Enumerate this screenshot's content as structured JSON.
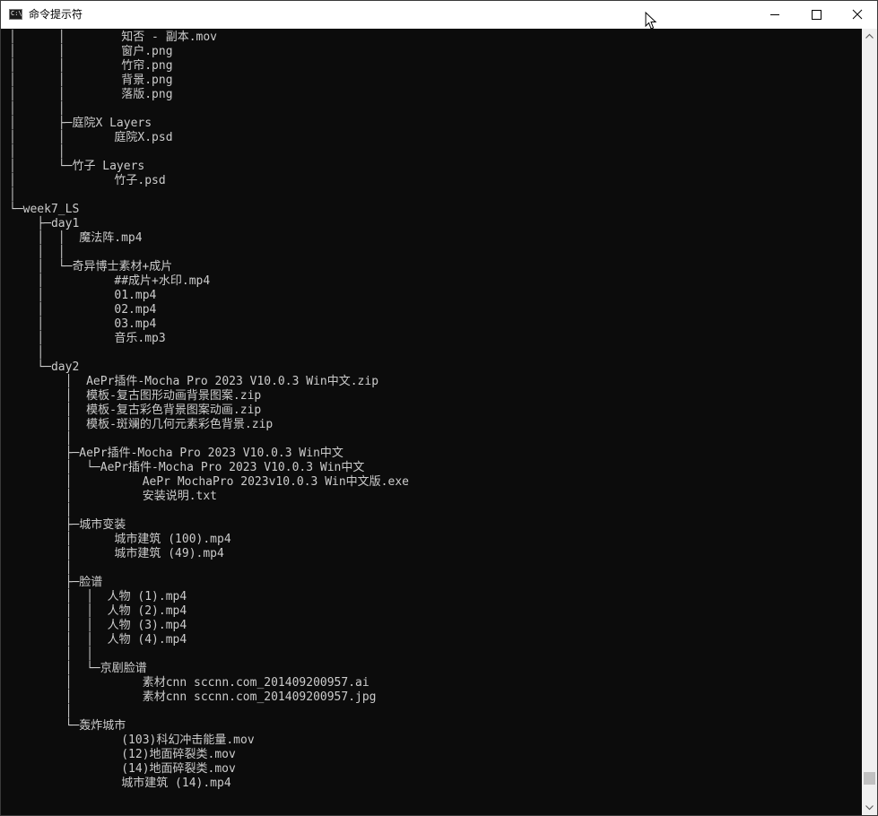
{
  "window": {
    "title": "命令提示符",
    "icon": "cmd-console-icon",
    "icon_text": "C:\\"
  },
  "controls": {
    "minimize": "minimize-icon",
    "maximize": "maximize-icon",
    "close": "close-icon"
  },
  "colors": {
    "console_background": "#0c0c0c",
    "console_text": "#cccccc",
    "titlebar_background": "#ffffff"
  },
  "console": {
    "lines": [
      "│      │        知否 - 副本.mov",
      "│      │        窗户.png",
      "│      │        竹帘.png",
      "│      │        背景.png",
      "│      │        落版.png",
      "│      │",
      "│      ├─庭院X Layers",
      "│      │       庭院X.psd",
      "│      │",
      "│      └─竹子 Layers",
      "│              竹子.psd",
      "│",
      "└─week7_LS",
      "    ├─day1",
      "    │  │  魔法阵.mp4",
      "    │  │",
      "    │  └─奇异博士素材+成片",
      "    │          ##成片+水印.mp4",
      "    │          01.mp4",
      "    │          02.mp4",
      "    │          03.mp4",
      "    │          音乐.mp3",
      "    │",
      "    └─day2",
      "        │  AePr插件-Mocha Pro 2023 V10.0.3 Win中文.zip",
      "        │  模板-复古图形动画背景图案.zip",
      "        │  模板-复古彩色背景图案动画.zip",
      "        │  模板-斑斓的几何元素彩色背景.zip",
      "        │",
      "        ├─AePr插件-Mocha Pro 2023 V10.0.3 Win中文",
      "        │  └─AePr插件-Mocha Pro 2023 V10.0.3 Win中文",
      "        │          AePr MochaPro 2023v10.0.3 Win中文版.exe",
      "        │          安装说明.txt",
      "        │",
      "        ├─城市变装",
      "        │      城市建筑 (100).mp4",
      "        │      城市建筑 (49).mp4",
      "        │",
      "        ├─脸谱",
      "        │  │  人物 (1).mp4",
      "        │  │  人物 (2).mp4",
      "        │  │  人物 (3).mp4",
      "        │  │  人物 (4).mp4",
      "        │  │",
      "        │  └─京剧脸谱",
      "        │          素材cnn sccnn.com_201409200957.ai",
      "        │          素材cnn sccnn.com_201409200957.jpg",
      "        │",
      "        └─轰炸城市",
      "                (103)科幻冲击能量.mov",
      "                (12)地面碎裂类.mov",
      "                (14)地面碎裂类.mov",
      "                城市建筑 (14).mp4"
    ]
  },
  "scrollbar": {
    "position": 0.98
  }
}
